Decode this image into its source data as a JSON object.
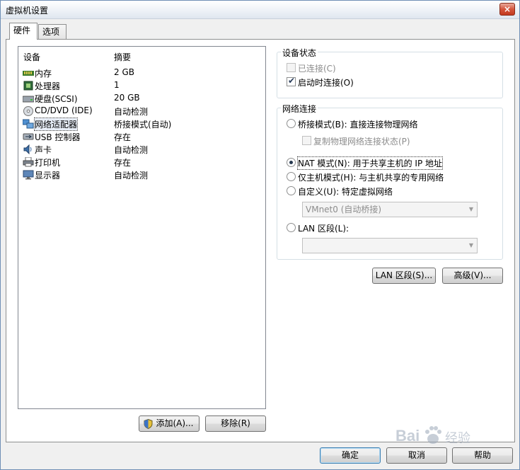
{
  "window": {
    "title": "虚拟机设置",
    "close_glyph": "×"
  },
  "tabs": [
    {
      "label": "硬件"
    },
    {
      "label": "选项"
    }
  ],
  "device_list": {
    "headers": {
      "device": "设备",
      "summary": "摘要"
    },
    "rows": [
      {
        "name": "内存",
        "summary": "2 GB",
        "icon": "memory-icon"
      },
      {
        "name": "处理器",
        "summary": "1",
        "icon": "processor-icon"
      },
      {
        "name": "硬盘(SCSI)",
        "summary": "20 GB",
        "icon": "hard-disk-icon"
      },
      {
        "name": "CD/DVD (IDE)",
        "summary": "自动检测",
        "icon": "cd-dvd-icon"
      },
      {
        "name": "网络适配器",
        "summary": "桥接模式(自动)",
        "icon": "network-adapter-icon"
      },
      {
        "name": "USB 控制器",
        "summary": "存在",
        "icon": "usb-controller-icon"
      },
      {
        "name": "声卡",
        "summary": "自动检测",
        "icon": "sound-card-icon"
      },
      {
        "name": "打印机",
        "summary": "存在",
        "icon": "printer-icon"
      },
      {
        "name": "显示器",
        "summary": "自动检测",
        "icon": "display-icon"
      }
    ],
    "add_label": "添加(A)...",
    "remove_label": "移除(R)"
  },
  "device_status": {
    "legend": "设备状态",
    "connected": {
      "label": "已连接(C)",
      "checked": false
    },
    "connect_at_power_on": {
      "label": "启动时连接(O)",
      "checked": true
    }
  },
  "network": {
    "legend": "网络连接",
    "bridged": {
      "label": "桥接模式(B): 直接连接物理网络",
      "selected": false
    },
    "replicate": {
      "label": "复制物理网络连接状态(P)",
      "checked": false
    },
    "nat": {
      "label": "NAT 模式(N): 用于共享主机的 IP 地址",
      "selected": true
    },
    "host_only": {
      "label": "仅主机模式(H): 与主机共享的专用网络",
      "selected": false
    },
    "custom": {
      "label": "自定义(U): 特定虚拟网络",
      "selected": false
    },
    "custom_combo_value": "VMnet0 (自动桥接)",
    "lan": {
      "label": "LAN 区段(L):",
      "selected": false
    },
    "lan_combo_value": ""
  },
  "buttons": {
    "lan_segments": "LAN 区段(S)...",
    "advanced": "高级(V)...",
    "ok": "确定",
    "cancel": "取消",
    "help": "帮助"
  },
  "watermark": {
    "text": "Bai",
    "text2": "经验"
  }
}
